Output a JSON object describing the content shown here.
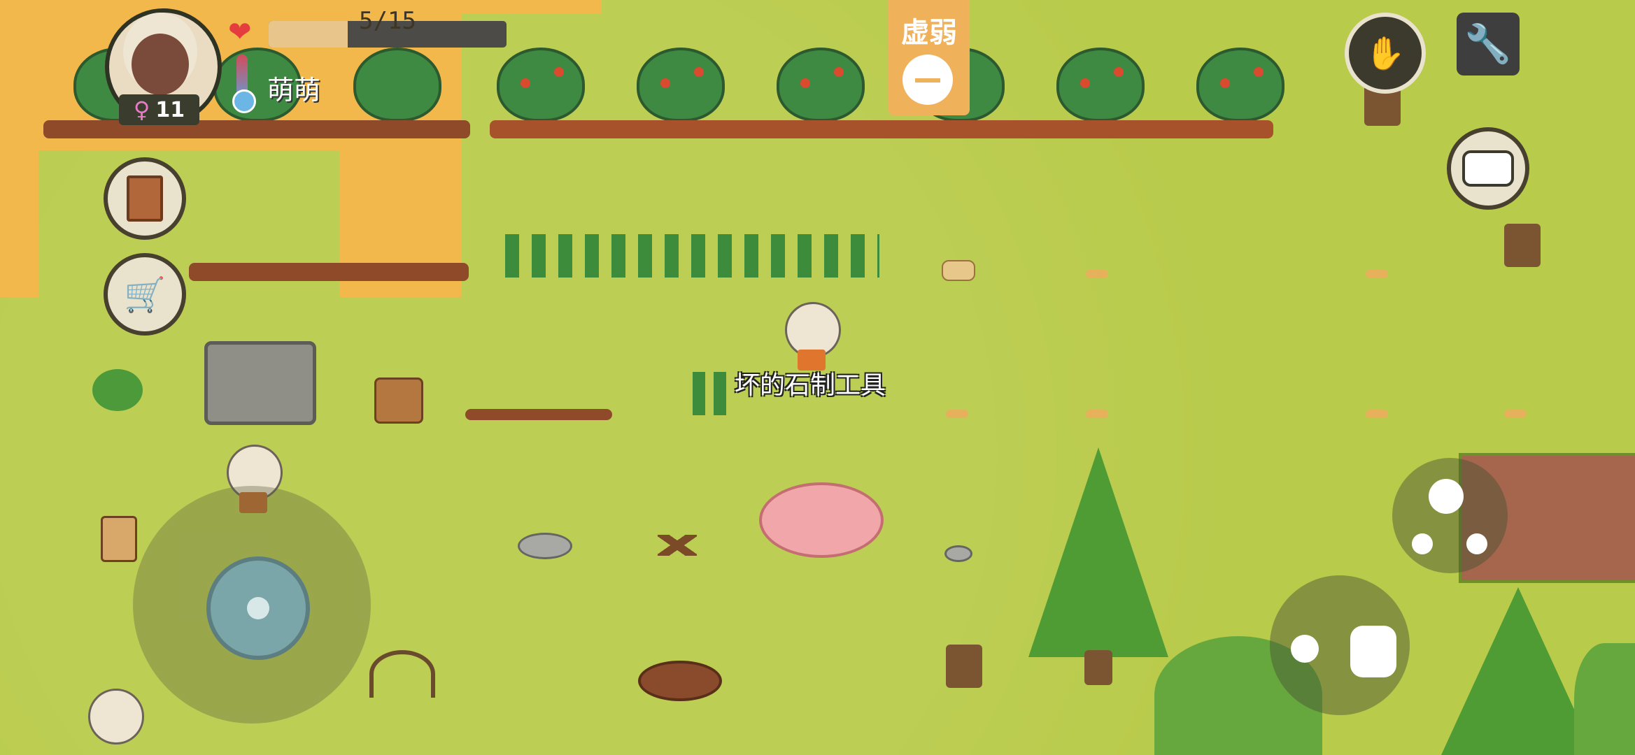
{
  "player": {
    "name": "萌萌",
    "gender_symbol": "♀",
    "age": "11",
    "health": {
      "current": 5,
      "max": 15,
      "label": "5/15"
    }
  },
  "status": {
    "label": "虚弱"
  },
  "world": {
    "item_label": "坏的石制工具"
  },
  "icons": {
    "heart": "heart-icon",
    "thermometer": "thermometer-icon",
    "journal": "book-icon",
    "shop": "shopping-cart-icon",
    "chat": "chat-bubble-icon",
    "settings": "wrench-icon",
    "pickup": "hand-icon",
    "throw": "throw-icon",
    "family": "family-tree-icon"
  },
  "colors": {
    "grass": "#b9cb4b",
    "status_panel": "#f0b15b",
    "health_fill": "#e7c58b",
    "health_bg": "#4d4b47",
    "heart": "#e53d3d"
  }
}
